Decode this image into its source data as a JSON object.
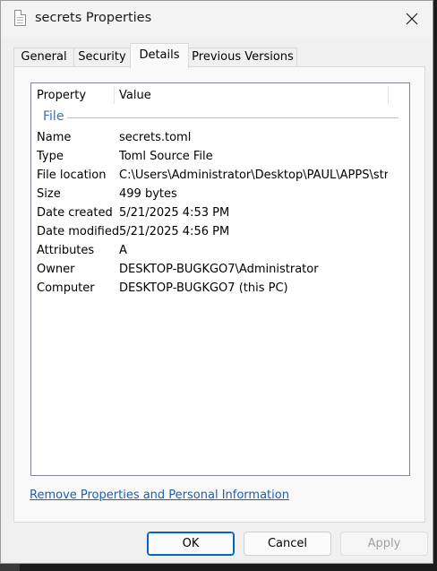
{
  "window": {
    "title": "secrets Properties"
  },
  "tabs": [
    {
      "label": "General"
    },
    {
      "label": "Security"
    },
    {
      "label": "Details"
    },
    {
      "label": "Previous Versions"
    }
  ],
  "details": {
    "header_property": "Property",
    "header_value": "Value",
    "group": "File",
    "rows": [
      {
        "property": "Name",
        "value": "secrets.toml"
      },
      {
        "property": "Type",
        "value": "Toml Source File"
      },
      {
        "property": "File location",
        "value": "C:\\Users\\Administrator\\Desktop\\PAUL\\APPS\\str..."
      },
      {
        "property": "Size",
        "value": "499 bytes"
      },
      {
        "property": "Date created",
        "value": "5/21/2025 4:53 PM"
      },
      {
        "property": "Date modified",
        "value": "5/21/2025 4:56 PM"
      },
      {
        "property": "Attributes",
        "value": "A"
      },
      {
        "property": "Owner",
        "value": "DESKTOP-BUGKGO7\\Administrator"
      },
      {
        "property": "Computer",
        "value": "DESKTOP-BUGKGO7 (this PC)"
      }
    ]
  },
  "remove_link": "Remove Properties and Personal Information",
  "buttons": {
    "ok": "OK",
    "cancel": "Cancel",
    "apply": "Apply"
  }
}
